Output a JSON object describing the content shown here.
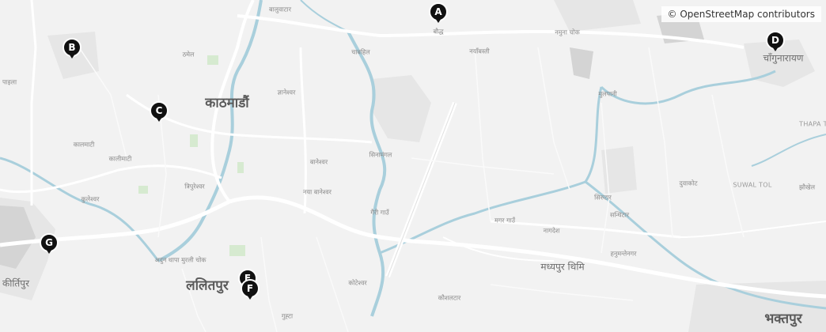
{
  "attribution": "© OpenStreetMap contributors",
  "labels": {
    "kathmandu": "काठमाडौं",
    "lalitpur": "ललितपुर",
    "bhaktapur": "भक्तपुर",
    "madhyapur": "मध्यपुर थिमि",
    "changunarayan": "चाँगुनारायण",
    "kirtipur": "कीर्तिपुर",
    "baluwatar": "बालुवाटार",
    "baudha": "बौद्ध",
    "chabahil": "चाबहिल",
    "thamel": "ठमेल",
    "jyatha": "ज्ञानेश्वर",
    "kalimati": "कालमाटी",
    "kalimati2": "कालीमाटी",
    "tripureshwar": "त्रिपुरेश्वर",
    "kuleshwar": "कुलेश्वर",
    "baneshwar": "बानेश्वर",
    "naya_baneshwar": "नया बानेश्वर",
    "sinamangal": "सिनामंगल",
    "gairigaun": "गैरी गाउँ",
    "koteshwar": "कोटेश्वर",
    "kaushaltar": "कौशलटार",
    "gwarko": "गुह्टा",
    "adarsha": "अदुन थापा मुरली चोक",
    "mulpani": "मुलपानी",
    "nayapaika": "नयाँबस्ती",
    "namuna": "नमुना चोक",
    "sanothimi": "सन्थिटार",
    "nagdesh": "नागदेश",
    "marga": "मगर गाउँ",
    "hanumante": "हनुमन्तेनगर",
    "duwakot": "दुवाकोट",
    "jhaukhel": "झौखेल",
    "suwal_tol": "SUWAL TOL",
    "thapa_tol": "THAPA T",
    "sirutar": "सिरुटार",
    "bhaisepati": "पाइला",
    "swayambhu": "स्वयम्भु"
  },
  "markers": [
    {
      "id": "A",
      "name": "marker-a"
    },
    {
      "id": "B",
      "name": "marker-b"
    },
    {
      "id": "C",
      "name": "marker-c"
    },
    {
      "id": "D",
      "name": "marker-d"
    },
    {
      "id": "E",
      "name": "marker-e"
    },
    {
      "id": "F",
      "name": "marker-f"
    },
    {
      "id": "G",
      "name": "marker-g"
    }
  ],
  "colors": {
    "water": "#a9cfdc",
    "park": "#d6ead0",
    "urban": "#e4e4e4",
    "road": "#ffffff",
    "marker": "#111111"
  }
}
